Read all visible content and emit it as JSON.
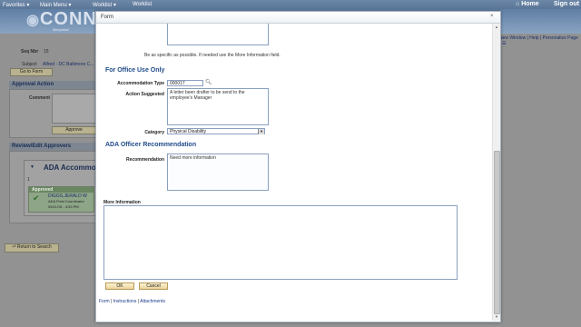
{
  "topbar": {
    "menu_items": [
      "Favorites",
      "Main Menu",
      "Worklist",
      "Worklist"
    ],
    "home": "Home",
    "signout": "Sign out"
  },
  "brand": {
    "name": "CONNE",
    "sub": "Maryland"
  },
  "background": {
    "seq_label": "Seq Nbr",
    "seq_value": "15",
    "subject_label": "Subject",
    "subject_value": "Alfred - DC Baltimore C...",
    "go_to_form": "Go to Form",
    "approval_action": "Approval Action",
    "comment_label": "Comment",
    "approve_button": "Approve",
    "review_approvers": "Review/Edit Approvers",
    "ada_heading": "ADA Accommod",
    "row_num": "1",
    "approved_label": "Approved",
    "approver_name": "DIGGS,JERALD W",
    "approver_role": "ADA Field Coordinator",
    "approver_date": "05/11/15 - 4:53 PM",
    "return_to_search": "Return to Search",
    "header_links": [
      "New Window",
      "Help",
      "Personalize Page"
    ]
  },
  "modal": {
    "title": "Form",
    "close": "×",
    "specific_note": "Be as specific as possible. If needed use the More Information field.",
    "office_use_title": "For Office Use Only",
    "accommodation_type_label": "Accommodation Type",
    "accommodation_type_value": "000017",
    "action_suggested_label": "Action Suggested",
    "action_suggested_value": "A letter been drafter to be send to the employee's Manager",
    "category_label": "Category",
    "category_value": "Physical Disability",
    "ada_officer_title": "ADA Officer Recommendation",
    "recommendation_label": "Recommendation",
    "recommendation_value": "Need more information",
    "more_info_label": "More Information",
    "more_info_value": "",
    "ok_button": "OK",
    "cancel_button": "Cancel",
    "footer_links": [
      "Form",
      "Instructions",
      "Attachments"
    ]
  },
  "colors": {
    "section_title": "#1f4b8a",
    "button_fill": "#ebd49a",
    "link": "#1b3a8a"
  }
}
